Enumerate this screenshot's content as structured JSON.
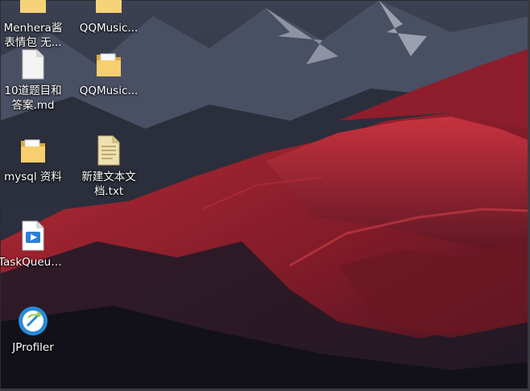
{
  "desktop": {
    "icons": [
      {
        "id": "menhera",
        "label": "Menhera酱表情包 无...",
        "icon": "folder-icon"
      },
      {
        "id": "qqmusic-top",
        "label": "QQMusic...",
        "icon": "folder-icon"
      },
      {
        "id": "readme",
        "label": "10道题目和答案.md",
        "icon": "document-icon"
      },
      {
        "id": "qqmusic",
        "label": "QQMusic...",
        "icon": "folder-icon"
      },
      {
        "id": "mysql",
        "label": "mysql 资料",
        "icon": "folder-icon"
      },
      {
        "id": "newtxt",
        "label": "新建文本文档.txt",
        "icon": "text-file-icon"
      },
      {
        "id": "taskqueue",
        "label": "TaskQueue...",
        "icon": "video-file-icon"
      },
      {
        "id": "jprofiler",
        "label": "JProfiler",
        "icon": "jprofiler-icon"
      }
    ]
  },
  "colors": {
    "sky": "#2a2f3f",
    "mountain_red": "#a3242f",
    "shadow": "#151620",
    "folder": "#f3c860"
  }
}
